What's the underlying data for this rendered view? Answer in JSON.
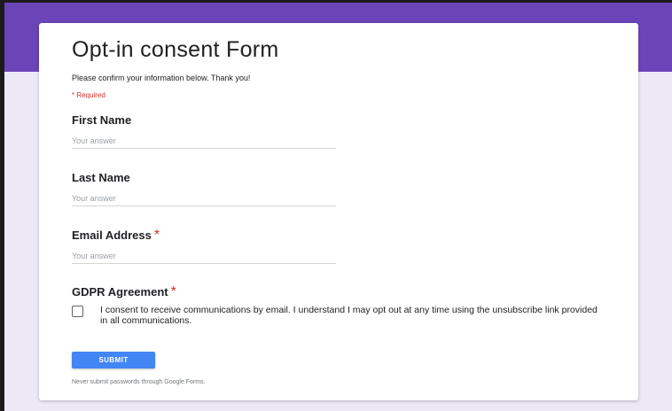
{
  "colors": {
    "header_band": "#6b44b8",
    "page_background": "#ece8f6",
    "required": "#d93025",
    "submit_button": "#4285f4"
  },
  "form": {
    "title": "Opt-in consent Form",
    "description": "Please confirm your information below. Thank you!",
    "required_note": "* Required",
    "questions": [
      {
        "label": "First Name",
        "required": false,
        "placeholder": "Your answer",
        "value": ""
      },
      {
        "label": "Last Name",
        "required": false,
        "placeholder": "Your answer",
        "value": ""
      },
      {
        "label": "Email Address",
        "required": true,
        "placeholder": "Your answer",
        "value": ""
      },
      {
        "label": "GDPR Agreement",
        "required": true
      }
    ],
    "required_marker": "*",
    "consent": {
      "checked": false,
      "text": "I consent to receive communications by email. I understand I may opt out at any time using the unsubscribe link provided in all communications."
    },
    "submit_label": "SUBMIT",
    "footer_note": "Never submit passwords through Google Forms."
  }
}
